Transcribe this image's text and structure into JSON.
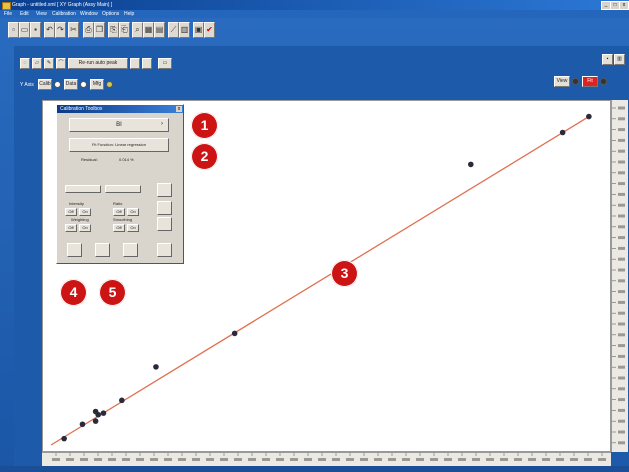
{
  "window": {
    "title": "Graph - untitled.xml [ XY Graph (Assy Main) ]",
    "controls": [
      "_",
      "□",
      "x"
    ]
  },
  "menu": [
    "File",
    "Edit",
    "View",
    "Calibration",
    "Window",
    "Options",
    "Help"
  ],
  "main_toolbar": {
    "icons": [
      "new-file-icon",
      "open-icon",
      "save-icon",
      "undo-icon",
      "redo-icon",
      "cut-icon",
      "print-icon",
      "copy-icon",
      "paste-icon",
      "paste-special-icon",
      "zoom-icon",
      "table-icon",
      "grid-icon",
      "graph-icon",
      "chart-icon",
      "report-icon",
      "export-icon"
    ]
  },
  "sub_toolbar": {
    "mode_label": "Re-run auto peak",
    "left_label": "Y Axis",
    "buttons": [
      "Calib",
      "Data",
      "Mfg"
    ],
    "right_icons": [
      "save-icon",
      "graph-icon"
    ],
    "right_buttons": [
      "View",
      "Fit"
    ]
  },
  "toolbox": {
    "title": "Calibration Toolbox",
    "field1_value": "BI",
    "field2_value": "Fit Function: Linear regression",
    "result_label": "Residual:",
    "result_value": "0.014 %",
    "section_labels": [
      "Intensity",
      "Ratio",
      "Weighting",
      "Smoothing"
    ],
    "toggles": [
      "Off",
      "On",
      "Off",
      "On",
      "Off",
      "On",
      "Off",
      "On"
    ]
  },
  "callouts": [
    "1",
    "2",
    "3",
    "4",
    "5"
  ],
  "colors": {
    "callout": "#cc1414",
    "fit_line": "#e07050",
    "points": "#2a2a3a",
    "window_bg": "#1d5aaa"
  },
  "chart_data": {
    "type": "scatter",
    "points": [
      [
        0.05,
        0.02
      ],
      [
        0.12,
        0.065
      ],
      [
        0.17,
        0.075
      ],
      [
        0.17,
        0.105
      ],
      [
        0.18,
        0.095
      ],
      [
        0.2,
        0.1
      ],
      [
        0.27,
        0.14
      ],
      [
        0.4,
        0.245
      ],
      [
        0.7,
        0.35
      ],
      [
        1.6,
        0.88
      ],
      [
        1.95,
        0.98
      ],
      [
        2.05,
        1.03
      ]
    ],
    "fit_line": {
      "x": [
        0.0,
        2.05
      ],
      "y": [
        0.0,
        1.03
      ]
    },
    "xlim": [
      0,
      2.1
    ],
    "ylim": [
      0,
      1.06
    ],
    "grid": false,
    "legend": "none"
  }
}
